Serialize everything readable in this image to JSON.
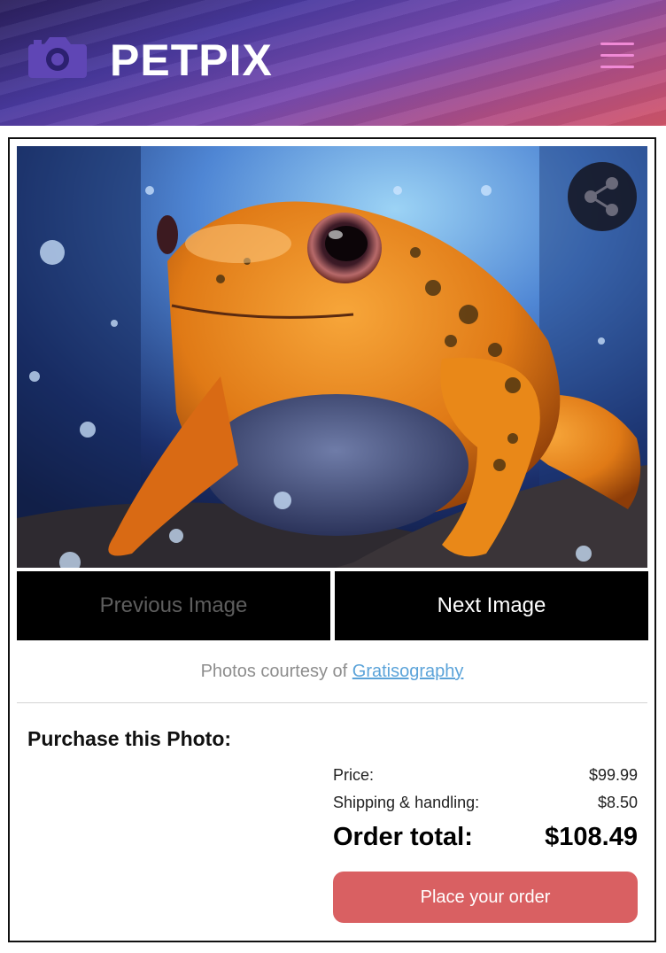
{
  "header": {
    "brand": "PETPIX",
    "logo_icon": "camera-icon",
    "menu_icon": "hamburger-menu-icon",
    "brand_color": "#ffffff",
    "menu_color": "#f08ad6"
  },
  "gallery": {
    "image_subject": "orange frog",
    "share_icon": "share-icon",
    "prev_label": "Previous Image",
    "next_label": "Next Image",
    "credit_text": "Photos courtesy of ",
    "credit_link": "Gratisography"
  },
  "purchase": {
    "title": "Purchase this Photo:",
    "price_label": "Price:",
    "price_value": "$99.99",
    "shipping_label": "Shipping & handling:",
    "shipping_value": "$8.50",
    "total_label": "Order total:",
    "total_value": "$108.49",
    "order_button": "Place your order",
    "button_color": "#d96062"
  }
}
